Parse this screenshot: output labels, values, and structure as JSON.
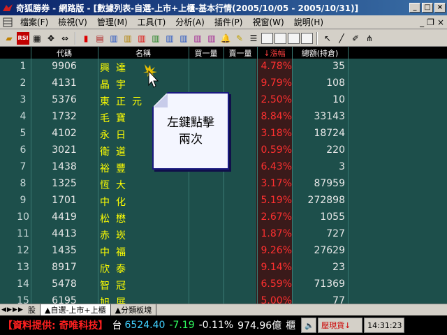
{
  "window": {
    "app_name": "奇狐勝券 - 網路版",
    "title": "奇狐勝券 - 網路版 - [數據列表-自選-上市+上櫃-基本行情(2005/10/05 - 2005/10/31)]"
  },
  "menu": {
    "items": [
      "檔案(F)",
      "檢視(V)",
      "管理(M)",
      "工具(T)",
      "分析(A)",
      "插件(P)",
      "視窗(W)",
      "說明(H)"
    ]
  },
  "toolbar": {
    "rsi_label": "RSI"
  },
  "table": {
    "headers": {
      "idx": "",
      "code": "代碼",
      "name": "名稱",
      "buy": "買一量",
      "sell": "賣一量",
      "pct": "↓漲幅",
      "value": "總額(持倉)"
    },
    "rows": [
      {
        "idx": "1",
        "code": "9906",
        "name": "興達",
        "pct": "4.78%",
        "value": "35"
      },
      {
        "idx": "2",
        "code": "4131",
        "name": "晶宇",
        "pct": "9.79%",
        "value": "108"
      },
      {
        "idx": "3",
        "code": "5376",
        "name": "東正元",
        "pct": "2.50%",
        "value": "10"
      },
      {
        "idx": "4",
        "code": "1732",
        "name": "毛寶",
        "pct": "8.84%",
        "value": "33143"
      },
      {
        "idx": "5",
        "code": "4102",
        "name": "永日",
        "pct": "3.18%",
        "value": "18724"
      },
      {
        "idx": "6",
        "code": "3021",
        "name": "衛道",
        "pct": "0.59%",
        "value": "220"
      },
      {
        "idx": "7",
        "code": "1438",
        "name": "裕豐",
        "pct": "6.43%",
        "value": "3"
      },
      {
        "idx": "8",
        "code": "1325",
        "name": "恆大",
        "pct": "3.17%",
        "value": "87959"
      },
      {
        "idx": "9",
        "code": "1701",
        "name": "中化",
        "pct": "5.19%",
        "value": "272898"
      },
      {
        "idx": "10",
        "code": "4419",
        "name": "松懋",
        "pct": "2.67%",
        "value": "1055"
      },
      {
        "idx": "11",
        "code": "4413",
        "name": "赤崁",
        "pct": "1.87%",
        "value": "727"
      },
      {
        "idx": "12",
        "code": "1435",
        "name": "中福",
        "pct": "9.26%",
        "value": "27629"
      },
      {
        "idx": "13",
        "code": "8917",
        "name": "欣泰",
        "pct": "9.14%",
        "value": "23"
      },
      {
        "idx": "14",
        "code": "5478",
        "name": "智冠",
        "pct": "6.59%",
        "value": "71369"
      },
      {
        "idx": "15",
        "code": "6195",
        "name": "旭展",
        "pct": "5.00%",
        "value": "77"
      }
    ]
  },
  "callout": {
    "line1": "左鍵點擊",
    "line2": "兩次"
  },
  "tabs": {
    "items": [
      "股",
      "▲自選-上市+上櫃",
      "▲分類板塊"
    ]
  },
  "statusbar": {
    "provider": "【資料提供: 奇唯科技】",
    "market": "台",
    "index": "6524.40",
    "change": "-7.19",
    "change_pct": "-0.11%",
    "volume": "974.96億",
    "unit": "櫃",
    "ticker_label": "壓現貨↓",
    "time": "14:31:23"
  },
  "colors": {
    "grid_bg": "#1d4f4b",
    "name_yellow": "#ffff00",
    "pct_red": "#ff3030",
    "title_blue": "#0a246a"
  }
}
